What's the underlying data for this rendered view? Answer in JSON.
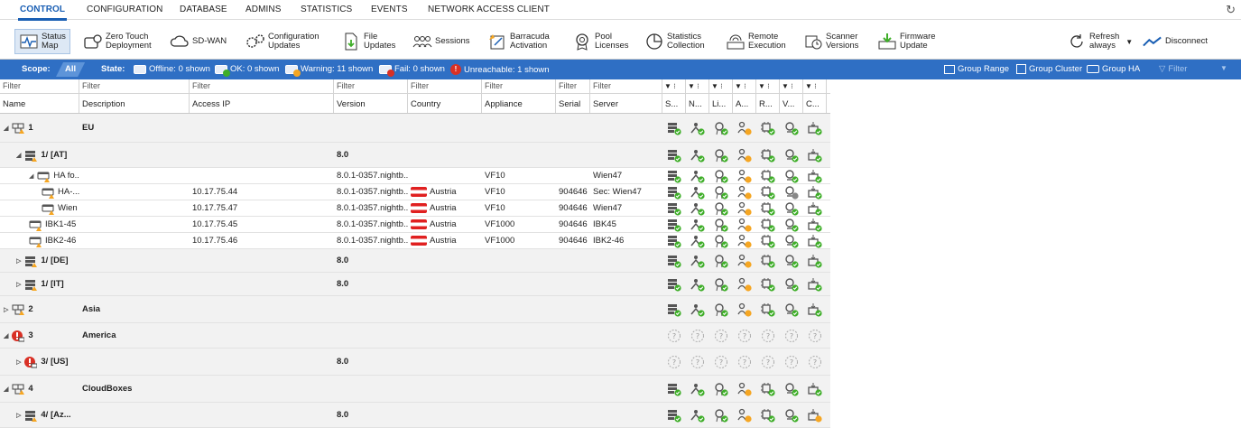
{
  "menu": {
    "tabs": [
      "CONTROL",
      "CONFIGURATION",
      "DATABASE",
      "ADMINS",
      "STATISTICS",
      "EVENTS",
      "NETWORK ACCESS CLIENT"
    ],
    "active": "CONTROL"
  },
  "ribbon": {
    "status_map": [
      "Status",
      "Map"
    ],
    "zero_touch": [
      "Zero Touch",
      "Deployment"
    ],
    "sdwan": [
      "SD-WAN"
    ],
    "config_updates": [
      "Configuration",
      "Updates"
    ],
    "file_updates": [
      "File",
      "Updates"
    ],
    "sessions": [
      "Sessions"
    ],
    "barracuda": [
      "Barracuda",
      "Activation"
    ],
    "pool": [
      "Pool",
      "Licenses"
    ],
    "statistics": [
      "Statistics",
      "Collection"
    ],
    "remote": [
      "Remote",
      "Execution"
    ],
    "scanner": [
      "Scanner",
      "Versions"
    ],
    "firmware": [
      "Firmware",
      "Update"
    ],
    "refresh": [
      "Refresh",
      "always"
    ],
    "disconnect": [
      "Disconnect"
    ]
  },
  "scope": {
    "scope_label": "Scope:",
    "scope_value": "All",
    "state_label": "State:",
    "offline": "Offline: 0 shown",
    "ok": "OK: 0 shown",
    "warning": "Warning: 11 shown",
    "fail": "Fail: 0 shown",
    "unreachable": "Unreachable: 1 shown",
    "group_range": "Group Range",
    "group_cluster": "Group Cluster",
    "group_ha": "Group HA",
    "filter": "Filter"
  },
  "grid": {
    "filter_placeholder": "Filter",
    "columns": [
      "Name",
      "Description",
      "Access IP",
      "Version",
      "Country",
      "Appliance",
      "Serial",
      "Server"
    ],
    "status_columns": [
      "S...",
      "N...",
      "Li...",
      "A...",
      "R...",
      "V...",
      "C..."
    ],
    "rows": [
      {
        "name": "1",
        "description": "EU",
        "access_ip": "",
        "version": "",
        "country": "",
        "appliance": "",
        "serial": "",
        "server": ""
      },
      {
        "name": "1/ [AT]",
        "description": "",
        "access_ip": "",
        "version": "8.0",
        "country": "",
        "appliance": "",
        "serial": "",
        "server": ""
      },
      {
        "name": "HA fo...",
        "description": "",
        "access_ip": "",
        "version": "8.0.1-0357.nightb...",
        "country": "",
        "appliance": "VF10",
        "serial": "",
        "server": "Wien47"
      },
      {
        "name": "HA-...",
        "description": "",
        "access_ip": "10.17.75.44",
        "version": "8.0.1-0357.nightb...",
        "country": "Austria",
        "appliance": "VF10",
        "serial": "904646",
        "server": "Sec: Wien47"
      },
      {
        "name": "Wien",
        "description": "",
        "access_ip": "10.17.75.47",
        "version": "8.0.1-0357.nightb...",
        "country": "Austria",
        "appliance": "VF10",
        "serial": "904646",
        "server": "Wien47"
      },
      {
        "name": "IBK1-45",
        "description": "",
        "access_ip": "10.17.75.45",
        "version": "8.0.1-0357.nightb...",
        "country": "Austria",
        "appliance": "VF1000",
        "serial": "904646",
        "server": "IBK45"
      },
      {
        "name": "IBK2-46",
        "description": "",
        "access_ip": "10.17.75.46",
        "version": "8.0.1-0357.nightb...",
        "country": "Austria",
        "appliance": "VF1000",
        "serial": "904646",
        "server": "IBK2-46"
      },
      {
        "name": "1/ [DE]",
        "description": "",
        "access_ip": "",
        "version": "8.0",
        "country": "",
        "appliance": "",
        "serial": "",
        "server": ""
      },
      {
        "name": "1/ [IT]",
        "description": "",
        "access_ip": "",
        "version": "8.0",
        "country": "",
        "appliance": "",
        "serial": "",
        "server": ""
      },
      {
        "name": "2",
        "description": "Asia",
        "access_ip": "",
        "version": "",
        "country": "",
        "appliance": "",
        "serial": "",
        "server": ""
      },
      {
        "name": "3",
        "description": "America",
        "access_ip": "",
        "version": "",
        "country": "",
        "appliance": "",
        "serial": "",
        "server": ""
      },
      {
        "name": "3/ [US]",
        "description": "",
        "access_ip": "",
        "version": "8.0",
        "country": "",
        "appliance": "",
        "serial": "",
        "server": ""
      },
      {
        "name": "4",
        "description": "CloudBoxes",
        "access_ip": "",
        "version": "",
        "country": "",
        "appliance": "",
        "serial": "",
        "server": ""
      },
      {
        "name": "4/ [Az...",
        "description": "",
        "access_ip": "",
        "version": "8.0",
        "country": "",
        "appliance": "",
        "serial": "",
        "server": ""
      }
    ]
  },
  "colors": {
    "accent": "#1a5fb4",
    "scope_bar": "#2f6fc4",
    "ok": "#3fae29",
    "warning": "#f5a623",
    "fail": "#d93025"
  }
}
